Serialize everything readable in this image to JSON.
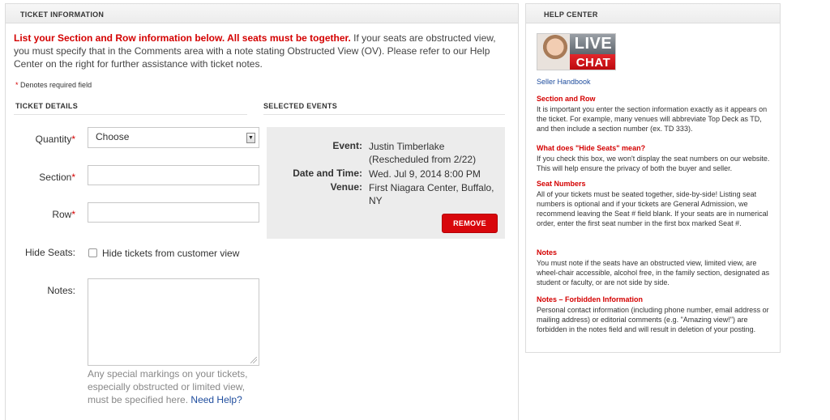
{
  "ticket_panel": {
    "header": "TICKET INFORMATION",
    "intro_emphasis": "List your Section and Row information below. All seats must be together.",
    "intro_rest": " If your seats are obstructed view, you must specify that in the Comments area with a note stating Obstructed View (OV). Please refer to our Help Center on the right for further assistance with ticket notes.",
    "required_star": "*",
    "required_text": " Denotes required field",
    "details_title": "TICKET DETAILS",
    "events_title": "SELECTED EVENTS",
    "quantity_label": "Quantity",
    "quantity_value": "Choose",
    "section_label": "Section",
    "row_label": "Row",
    "star": "*",
    "hide_seats_label": "Hide Seats:",
    "hide_seats_checkbox_label": "Hide tickets from customer view",
    "notes_label": "Notes:",
    "notes_hint": "Any special markings on your tickets, especially obstructed or limited view, must be specified here. ",
    "need_help_link": "Need Help?"
  },
  "selected_event": {
    "event_label": "Event:",
    "event_value": "Justin Timberlake (Rescheduled from 2/22)",
    "datetime_label": "Date and Time:",
    "datetime_value": "Wed. Jul 9, 2014 8:00 PM",
    "venue_label": "Venue:",
    "venue_value": "First Niagara Center, Buffalo, NY",
    "remove_button": "REMOVE"
  },
  "help_center": {
    "header": "HELP CENTER",
    "live_text": "LIVE",
    "chat_text": "CHAT",
    "seller_handbook_link": "Seller Handbook",
    "sections": [
      {
        "title": "Section and Row",
        "text": "It is important you enter the section information exactly as it appears on the ticket. For example, many venues will abbreviate Top Deck as TD, and then include a section number (ex. TD 333)."
      },
      {
        "title": "What does \"Hide Seats\" mean?",
        "text": "If you check this box, we won't display the seat numbers on our website. This will help ensure the privacy of both the buyer and seller."
      },
      {
        "title": "Seat Numbers",
        "text": "All of your tickets must be seated together, side-by-side! Listing seat numbers is optional and if your tickets are General Admission, we recommend leaving the Seat # field blank. If your seats are in numerical order, enter the first seat number in the first box marked Seat #."
      },
      {
        "title": "Notes",
        "text": "You must note if the seats have an obstructed view, limited view, are wheel-chair accessible, alcohol free, in the family section, designated as student or faculty, or are not side by side."
      },
      {
        "title": "Notes – Forbidden Information",
        "text": "Personal contact information (including phone number, email address or mailing address) or editorial comments (e.g. \"Amazing view!\") are forbidden in the notes field and will result in deletion of your posting."
      }
    ]
  },
  "colors": {
    "accent_red": "#d40000",
    "button_red": "#d8070c",
    "link_blue": "#1f4d9e",
    "panel_gray": "#ececec"
  }
}
